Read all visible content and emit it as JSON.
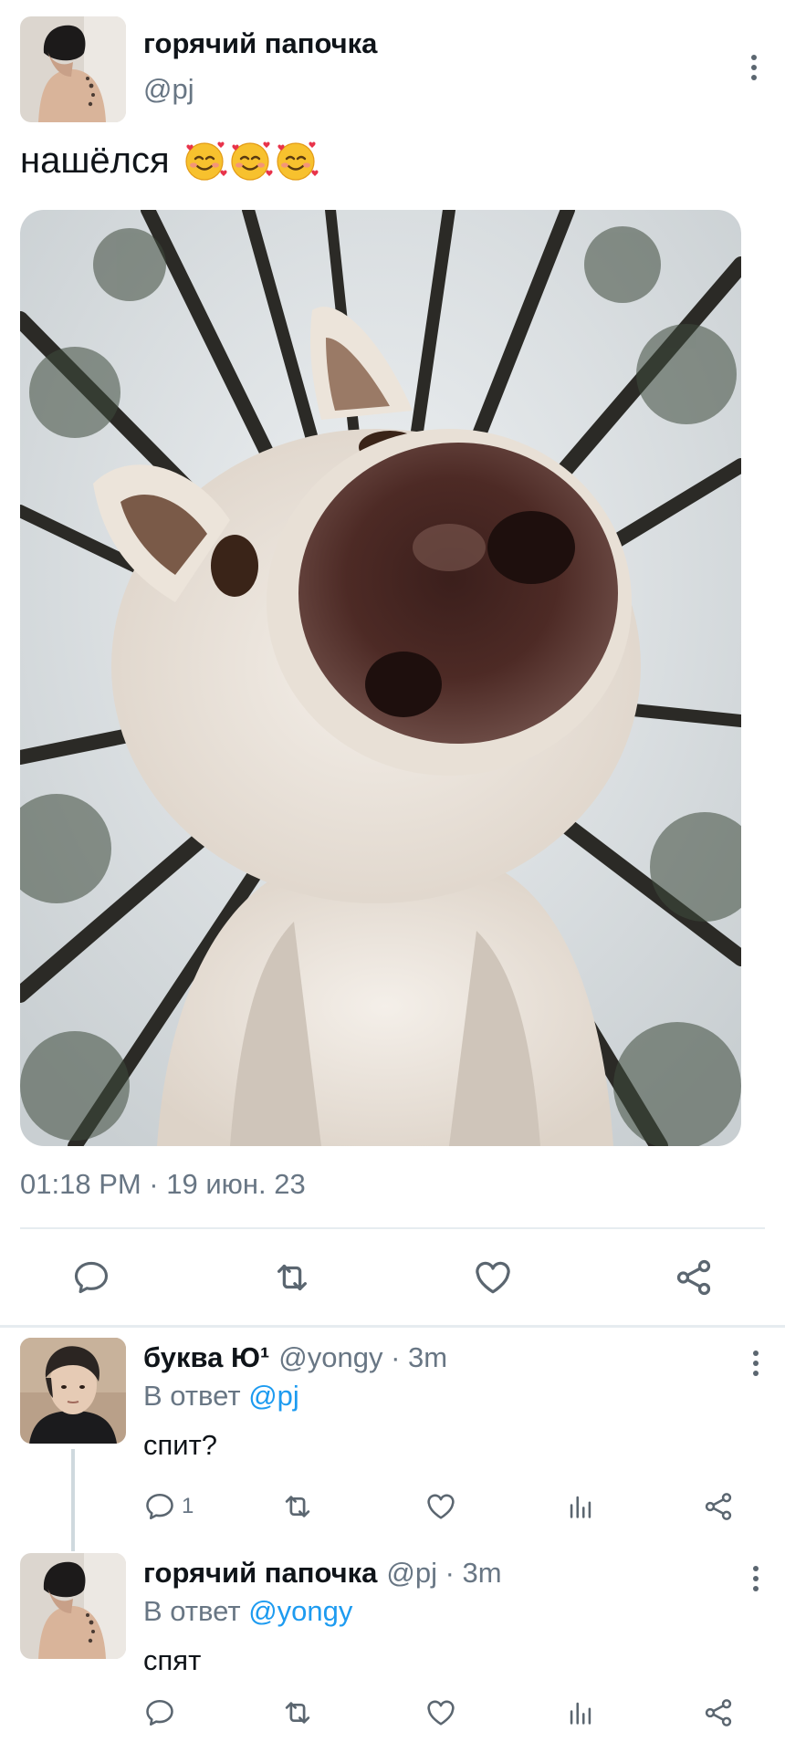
{
  "tweet": {
    "author_name": "горячий папочка",
    "author_handle": "@pj",
    "text": "нашёлся",
    "emoji": [
      "smiling-face-with-hearts",
      "smiling-face-with-hearts",
      "smiling-face-with-hearts"
    ],
    "timestamp": "01:18 PM · 19 июн. 23",
    "actions": [
      "reply-icon",
      "retweet-icon",
      "like-icon",
      "share-icon"
    ]
  },
  "replies": [
    {
      "author_name": "буква Ю¹",
      "meta": "@yongy · 3m",
      "reply_prefix": "В ответ",
      "reply_to": "@pj",
      "text": "спит?",
      "reply_count": "1"
    },
    {
      "author_name": "горячий папочка",
      "meta": "@pj · 3m",
      "reply_prefix": "В ответ",
      "reply_to": "@yongy",
      "text": "спят",
      "reply_count": ""
    }
  ],
  "colors": {
    "text": "#0f1419",
    "secondary": "#687684",
    "link": "#1d9bf0",
    "divider": "#e6ecf0"
  }
}
